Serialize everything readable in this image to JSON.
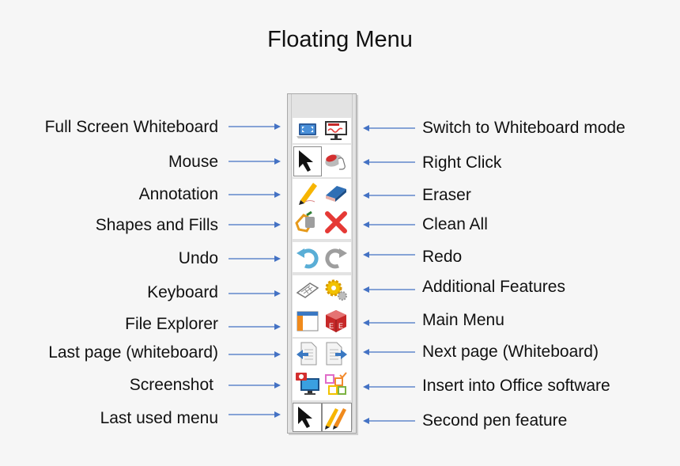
{
  "title": "Floating Menu",
  "colors": {
    "arrow": "#4472c4",
    "background": "#f6f6f6",
    "toolbar_frame": "#e3e3e3"
  },
  "left_labels": [
    {
      "label": "Full Screen Whiteboard",
      "icon": "fullscreen-laptop-icon"
    },
    {
      "label": "Mouse",
      "icon": "mouse-pointer-icon"
    },
    {
      "label": "Annotation",
      "icon": "pencil-icon"
    },
    {
      "label": "Shapes and Fills",
      "icon": "paint-bucket-icon"
    },
    {
      "label": "Undo",
      "icon": "undo-icon"
    },
    {
      "label": "Keyboard",
      "icon": "keyboard-icon"
    },
    {
      "label": "File Explorer",
      "icon": "window-icon"
    },
    {
      "label": "Last page (whiteboard)",
      "icon": "page-left-icon"
    },
    {
      "label": "Screenshot ",
      "icon": "camera-monitor-icon"
    },
    {
      "label": "Last used menu",
      "icon": "mouse-pointer-icon"
    }
  ],
  "right_labels": [
    {
      "label": "Switch to Whiteboard mode",
      "icon": "whiteboard-monitor-icon"
    },
    {
      "label": "Right Click",
      "icon": "right-click-mouse-icon"
    },
    {
      "label": "Eraser",
      "icon": "eraser-icon"
    },
    {
      "label": "Clean All",
      "icon": "red-x-icon"
    },
    {
      "label": "Redo",
      "icon": "redo-icon"
    },
    {
      "label": "Additional Features",
      "icon": "gears-icon"
    },
    {
      "label": "Main Menu",
      "icon": "red-cube-icon"
    },
    {
      "label": "Next page (Whiteboard)",
      "icon": "page-right-icon"
    },
    {
      "label": "Insert into Office software",
      "icon": "office-blocks-icon"
    },
    {
      "label": "Second pen feature",
      "icon": "double-pen-icon"
    }
  ]
}
